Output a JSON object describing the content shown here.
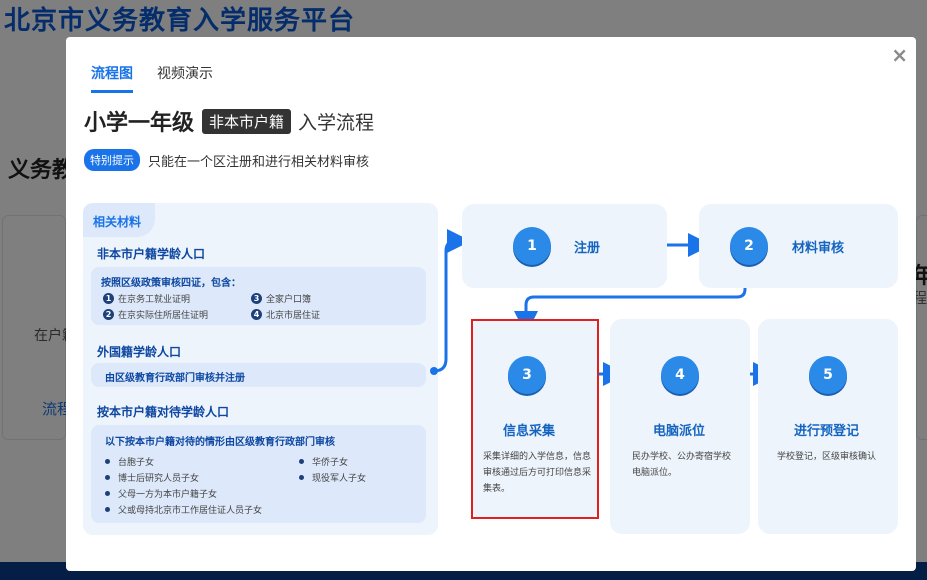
{
  "background": {
    "site_title": "北京市义务教育入学服务平台",
    "section_title": "义务教",
    "card_text": "在户籍",
    "card_link": "流程",
    "right_text": "年",
    "right_sub": "程"
  },
  "modal": {
    "close": "×",
    "tabs": [
      "流程图",
      "视频演示"
    ],
    "heading": {
      "main": "小学一年级",
      "tag": "非本市户籍",
      "after": "入学流程"
    },
    "notice": {
      "badge": "特别提示",
      "text": "只能在一个区注册和进行相关材料审核"
    },
    "materials": {
      "tab": "相关材料",
      "group1": {
        "title": "非本市户籍学龄人口",
        "box_title": "按照区级政策审核四证，包含：",
        "items": [
          {
            "num": "1",
            "text": "在京务工就业证明"
          },
          {
            "num": "2",
            "text": "在京实际住所居住证明"
          },
          {
            "num": "3",
            "text": "全家户口簿"
          },
          {
            "num": "4",
            "text": "北京市居住证"
          }
        ]
      },
      "group2": {
        "title": "外国籍学龄人口",
        "box_title": "由区级教育行政部门审核并注册"
      },
      "group3": {
        "title": "按本市户籍对待学龄人口",
        "box_title": "以下按本市户籍对待的情形由区级教育行政部门审核",
        "items": [
          "台胞子女",
          "博士后研究人员子女",
          "父母一方为本市户籍子女",
          "父或母持北京市工作居住证人员子女",
          "华侨子女",
          "现役军人子女"
        ]
      }
    },
    "steps": [
      {
        "num": "1",
        "name": "注册",
        "desc": ""
      },
      {
        "num": "2",
        "name": "材料审核",
        "desc": ""
      },
      {
        "num": "3",
        "name": "信息采集",
        "desc": "采集详细的入学信息，信息审核通过后方可打印信息采集表。"
      },
      {
        "num": "4",
        "name": "电脑派位",
        "desc": "民办学校、公办寄宿学校电脑派位。"
      },
      {
        "num": "5",
        "name": "进行预登记",
        "desc": "学校登记，区级审核确认"
      }
    ]
  },
  "colors": {
    "accent": "#1a73e8",
    "highlight": "#e02020",
    "panel": "#eef4fc"
  }
}
